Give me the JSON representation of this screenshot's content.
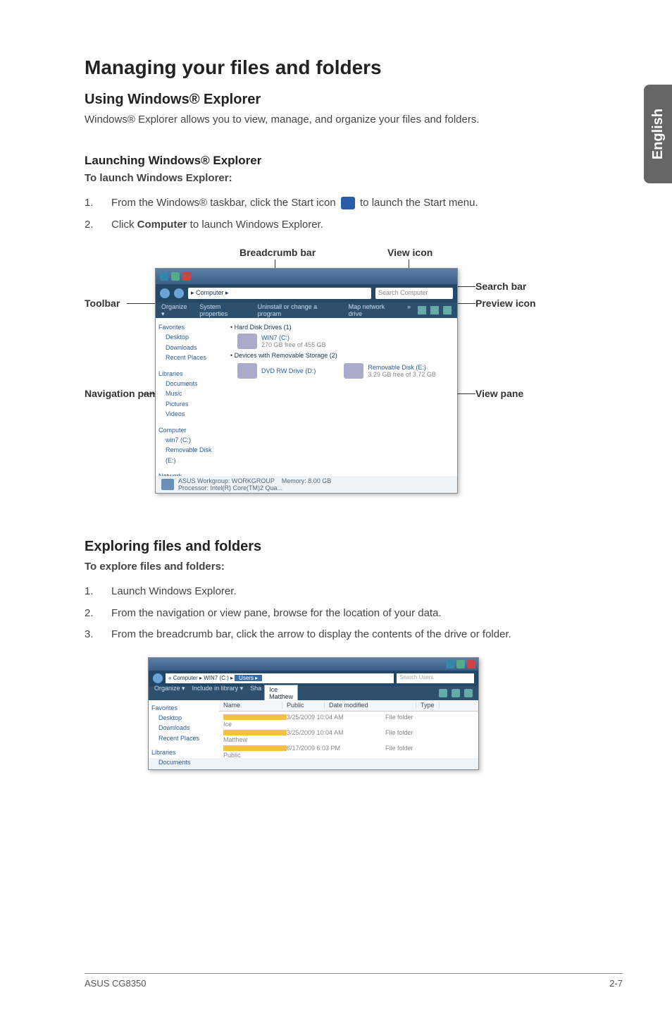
{
  "sideTab": "English",
  "h1": "Managing your files and folders",
  "sec1": {
    "h2": "Using Windows® Explorer",
    "p": "Windows® Explorer allows you to view, manage, and organize your files and folders."
  },
  "sec2": {
    "h3": "Launching Windows® Explorer",
    "lead": "To launch Windows Explorer:",
    "steps": [
      {
        "n": "1.",
        "pre": "From the Windows® taskbar, click the Start icon ",
        "post": " to launch the Start menu."
      },
      {
        "n": "2.",
        "pre": "Click ",
        "bold": "Computer",
        "post": " to launch Windows Explorer."
      }
    ]
  },
  "annot1": {
    "labels": {
      "breadcrumb": "Breadcrumb bar",
      "viewicon": "View icon",
      "toolbar": "Toolbar",
      "searchbar": "Search bar",
      "previewicon": "Preview icon",
      "navpane": "Navigation pane",
      "viewpane": "View pane"
    },
    "win": {
      "bc": "▸ Computer ▸",
      "srch": "Search Computer",
      "tbar": [
        "Organize ▾",
        "System properties",
        "Uninstall or change a program",
        "Map network drive",
        "»"
      ],
      "nav": {
        "fav": "Favorites",
        "favItems": [
          "Desktop",
          "Downloads",
          "Recent Places"
        ],
        "lib": "Libraries",
        "libItems": [
          "Documents",
          "Music",
          "Pictures",
          "Videos"
        ],
        "comp": "Computer",
        "compItems": [
          "win7 (C:)",
          "Removable Disk (E:)"
        ],
        "net": "Network"
      },
      "content": {
        "hd1": "• Hard Disk Drives (1)",
        "d1name": "WIN7 (C:)",
        "d1sub": "270 GB free of 455 GB",
        "hd2": "• Devices with Removable Storage (2)",
        "d2name": "DVD RW Drive (D:)",
        "d3name": "Removable Disk (E:)",
        "d3sub": "3.29 GB free of 3.72 GB"
      },
      "status1": "ASUS Workgroup: WORKGROUP",
      "status2": "Processor: Intel(R) Core(TM)2 Qua...",
      "status3": "Memory: 8.00 GB"
    }
  },
  "sec3": {
    "h2": "Exploring files and folders",
    "lead": "To explore files and folders:",
    "steps": [
      {
        "n": "1.",
        "t": "Launch Windows Explorer."
      },
      {
        "n": "2.",
        "t": "From the navigation or view pane, browse for the location of your data."
      },
      {
        "n": "3.",
        "t": "From the breadcrumb bar, click the arrow to display the contents of the drive or folder."
      }
    ]
  },
  "shot2": {
    "bc1": "« Computer ▸ WIN7 (C:) ▸",
    "bcSel": "Users ▸",
    "srch": "Search Users",
    "tbar": [
      "Organize ▾",
      "Include in library ▾",
      "Sha"
    ],
    "tmenu": [
      "Ice",
      "Matthew"
    ],
    "cols": [
      "Name",
      "",
      "Date modified",
      "Type"
    ],
    "nav": {
      "fav": "Favorites",
      "favItems": [
        "Desktop",
        "Downloads",
        "Recent Places"
      ],
      "lib": "Libraries",
      "libItems": [
        "Documents"
      ]
    },
    "rows": [
      {
        "n": "Ice",
        "d": "3/25/2009 10:04 AM",
        "t": "File folder"
      },
      {
        "n": "Matthew",
        "d": "3/25/2009 10:04 AM",
        "t": "File folder"
      },
      {
        "n": "Public",
        "d": "6/17/2009 6:03 PM",
        "t": "File folder"
      }
    ],
    "colPublic": "Public"
  },
  "footer": {
    "left": "ASUS CG8350",
    "right": "2-7"
  }
}
